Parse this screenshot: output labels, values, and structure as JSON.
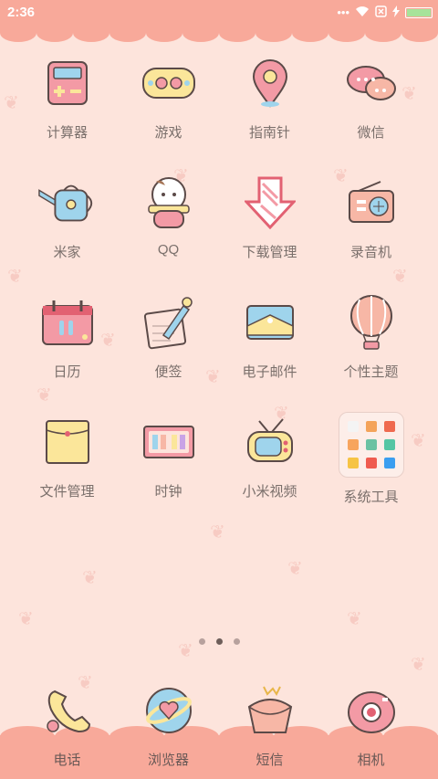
{
  "status_bar": {
    "time": "2:36",
    "icons": [
      "more-dots-icon",
      "wifi-icon",
      "no-sim-icon",
      "charging-icon",
      "battery-icon"
    ]
  },
  "apps": [
    {
      "label": "计算器",
      "icon": "calculator-icon"
    },
    {
      "label": "游戏",
      "icon": "gamepad-icon"
    },
    {
      "label": "指南针",
      "icon": "compass-pin-icon"
    },
    {
      "label": "微信",
      "icon": "chat-bubbles-icon"
    },
    {
      "label": "米家",
      "icon": "watering-can-icon"
    },
    {
      "label": "QQ",
      "icon": "penguin-icon"
    },
    {
      "label": "下载管理",
      "icon": "download-arrow-icon"
    },
    {
      "label": "录音机",
      "icon": "radio-icon"
    },
    {
      "label": "日历",
      "icon": "calendar-icon"
    },
    {
      "label": "便签",
      "icon": "note-pencil-icon"
    },
    {
      "label": "电子邮件",
      "icon": "envelope-icon"
    },
    {
      "label": "个性主题",
      "icon": "hot-air-balloon-icon"
    },
    {
      "label": "文件管理",
      "icon": "folder-icon"
    },
    {
      "label": "时钟",
      "icon": "clock-icon"
    },
    {
      "label": "小米视频",
      "icon": "tv-icon"
    },
    {
      "label": "系统工具",
      "icon": "app-folder-icon"
    }
  ],
  "pager": {
    "count": 3,
    "active_index": 1
  },
  "dock": [
    {
      "label": "电话",
      "icon": "phone-icon"
    },
    {
      "label": "浏览器",
      "icon": "browser-globe-icon"
    },
    {
      "label": "短信",
      "icon": "message-bag-icon"
    },
    {
      "label": "相机",
      "icon": "camera-donut-icon"
    }
  ],
  "colors": {
    "background": "#fde4dc",
    "accent": "#f8a99a",
    "label": "#7a6f6b"
  }
}
